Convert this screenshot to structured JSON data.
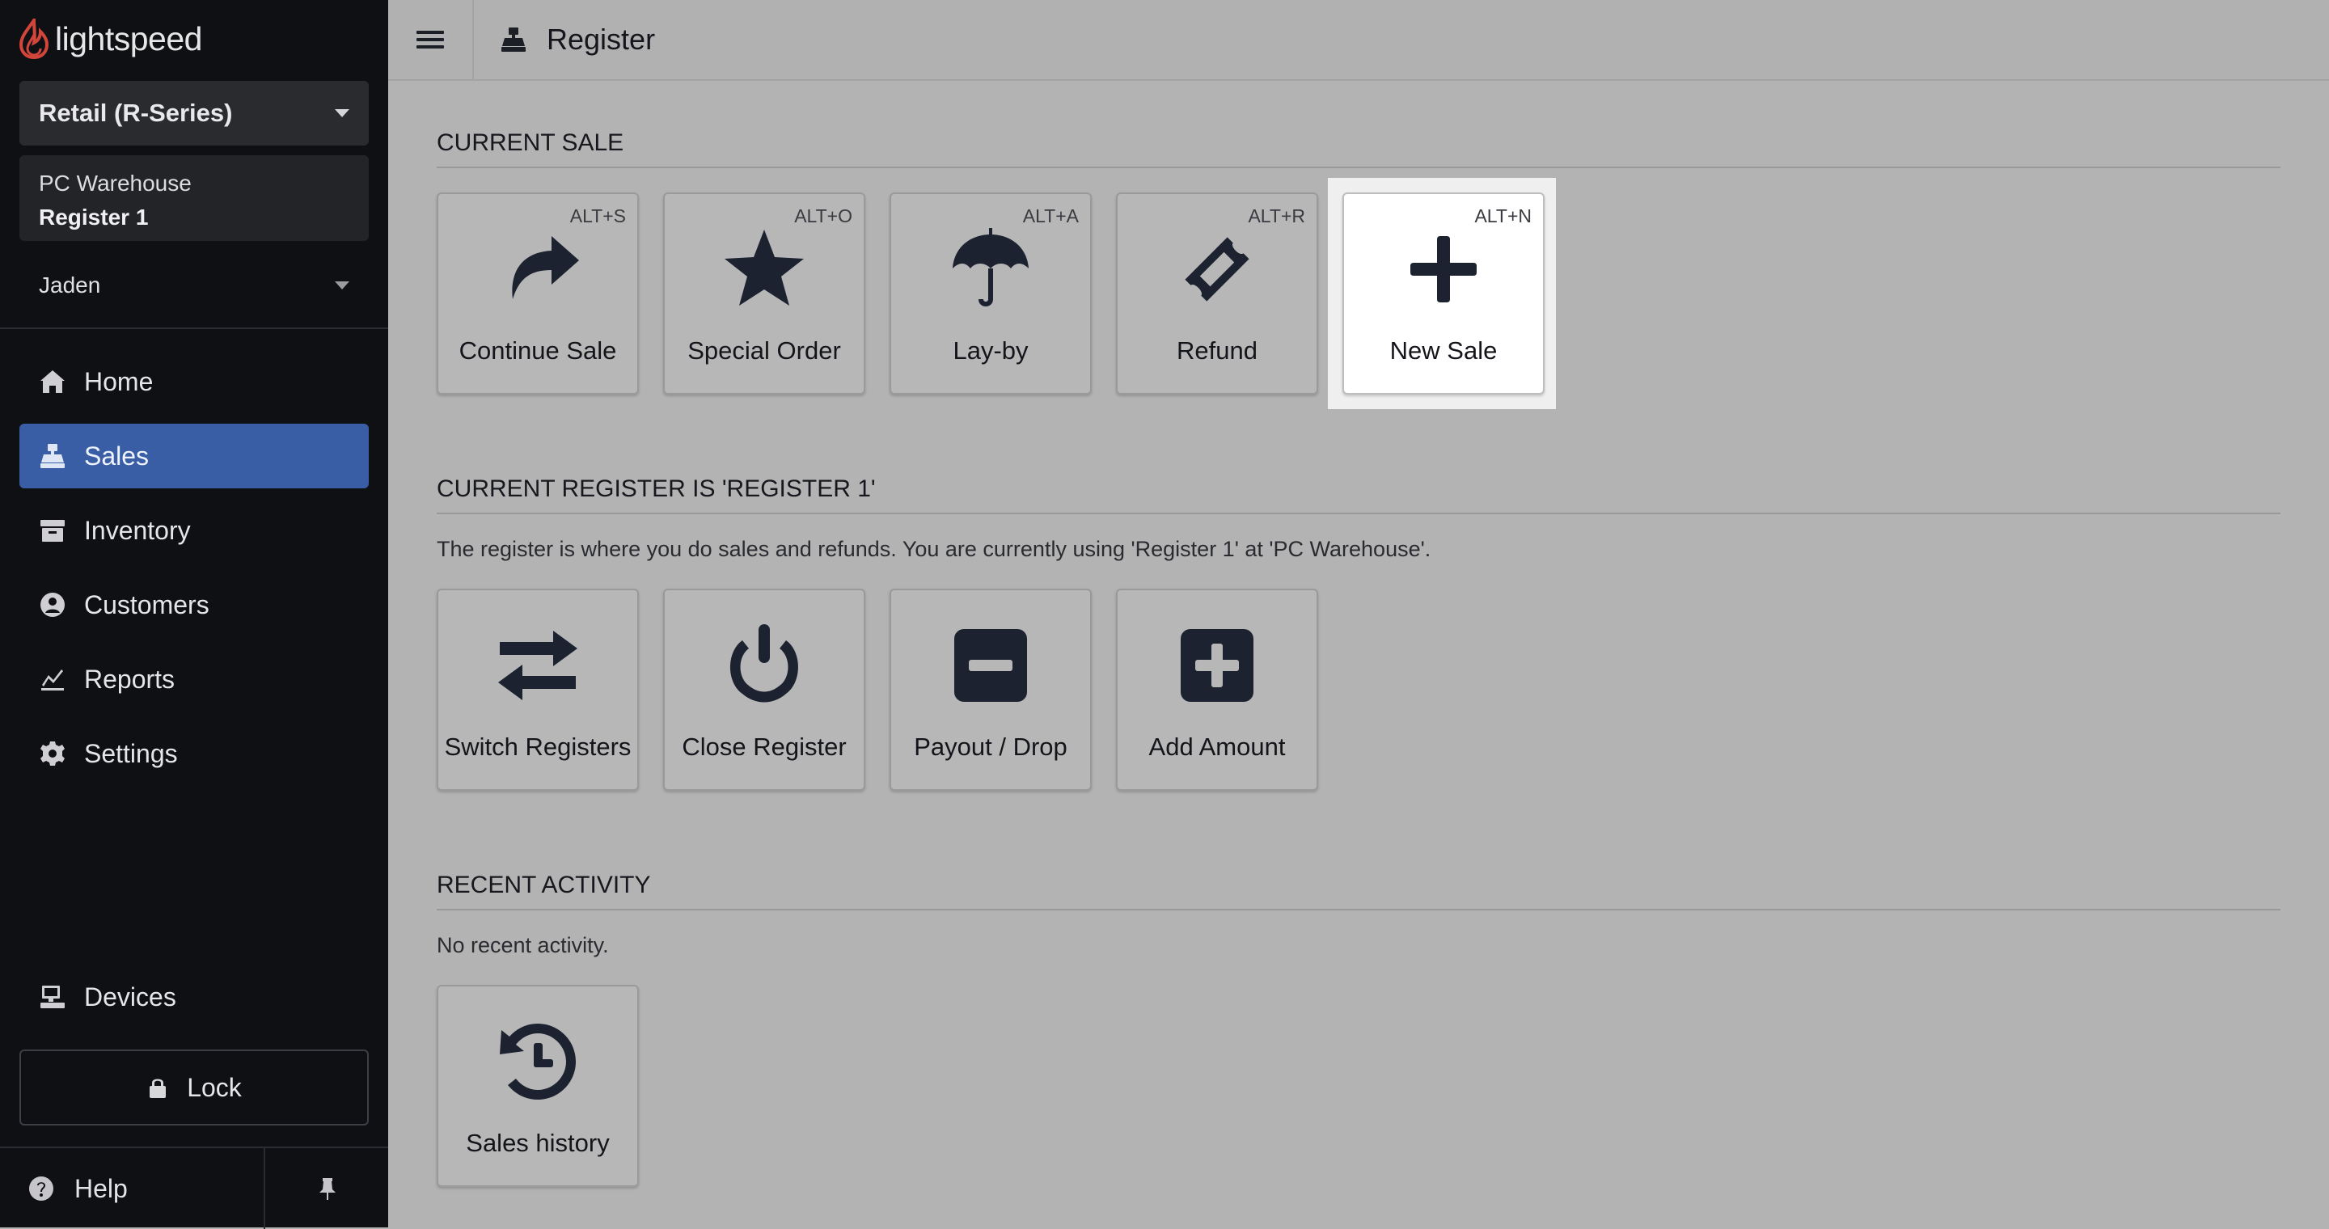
{
  "brand": {
    "logo_text": "lightspeed"
  },
  "sidebar": {
    "product": "Retail (R-Series)",
    "location": "PC Warehouse",
    "register": "Register 1",
    "user": "Jaden",
    "nav": [
      {
        "label": "Home",
        "icon": "home-icon"
      },
      {
        "label": "Sales",
        "icon": "register-icon",
        "active": true
      },
      {
        "label": "Inventory",
        "icon": "inventory-icon"
      },
      {
        "label": "Customers",
        "icon": "customer-icon"
      },
      {
        "label": "Reports",
        "icon": "chart-icon"
      },
      {
        "label": "Settings",
        "icon": "gear-icon"
      }
    ],
    "devices": "Devices",
    "lock": "Lock",
    "help": "Help"
  },
  "topbar": {
    "title": "Register"
  },
  "current_sale": {
    "title": "CURRENT SALE",
    "tiles": [
      {
        "label": "Continue Sale",
        "shortcut": "ALT+S",
        "icon": "share-arrow-icon"
      },
      {
        "label": "Special Order",
        "shortcut": "ALT+O",
        "icon": "star-icon"
      },
      {
        "label": "Lay-by",
        "shortcut": "ALT+A",
        "icon": "umbrella-icon"
      },
      {
        "label": "Refund",
        "shortcut": "ALT+R",
        "icon": "ticket-icon"
      },
      {
        "label": "New Sale",
        "shortcut": "ALT+N",
        "icon": "plus-icon"
      }
    ]
  },
  "current_register": {
    "title": "CURRENT REGISTER IS 'REGISTER 1'",
    "description": "The register is where you do sales and refunds. You are currently using 'Register 1'  at 'PC Warehouse'.",
    "tiles": [
      {
        "label": "Switch Registers",
        "icon": "exchange-icon"
      },
      {
        "label": "Close Register",
        "icon": "power-icon"
      },
      {
        "label": "Payout / Drop",
        "icon": "minus-square-icon"
      },
      {
        "label": "Add Amount",
        "icon": "plus-square-icon"
      }
    ]
  },
  "recent_activity": {
    "title": "RECENT ACTIVITY",
    "empty_text": "No recent activity.",
    "tiles": [
      {
        "label": "Sales history",
        "icon": "history-icon"
      }
    ]
  },
  "colors": {
    "sidebar_bg": "#0f1014",
    "active_nav": "#3a5ea6",
    "main_bg": "#b3b3b3",
    "brand_red": "#d1453b"
  }
}
